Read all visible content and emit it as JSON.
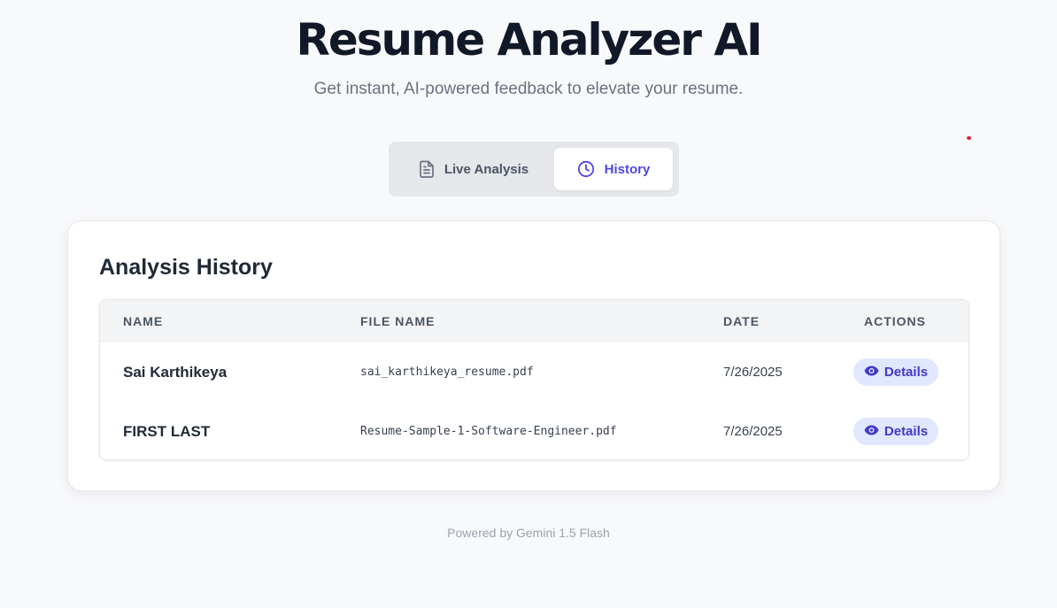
{
  "header": {
    "title": "Resume Analyzer AI",
    "subtitle": "Get instant, AI-powered feedback to elevate your resume."
  },
  "tabs": [
    {
      "label": "Live Analysis",
      "icon": "document-icon",
      "active": false
    },
    {
      "label": "History",
      "icon": "clock-icon",
      "active": true
    }
  ],
  "history": {
    "title": "Analysis History",
    "columns": [
      "NAME",
      "FILE NAME",
      "DATE",
      "ACTIONS"
    ],
    "rows": [
      {
        "name": "Sai Karthikeya",
        "file": "sai_karthikeya_resume.pdf",
        "date": "7/26/2025",
        "action": "Details"
      },
      {
        "name": "FIRST LAST",
        "file": "Resume-Sample-1-Software-Engineer.pdf",
        "date": "7/26/2025",
        "action": "Details"
      }
    ]
  },
  "footer": {
    "text": "Powered by Gemini 1.5 Flash"
  },
  "colors": {
    "accent": "#4f46e5",
    "badge_bg": "#e0e7ff",
    "page_bg": "#f8f9fb"
  }
}
